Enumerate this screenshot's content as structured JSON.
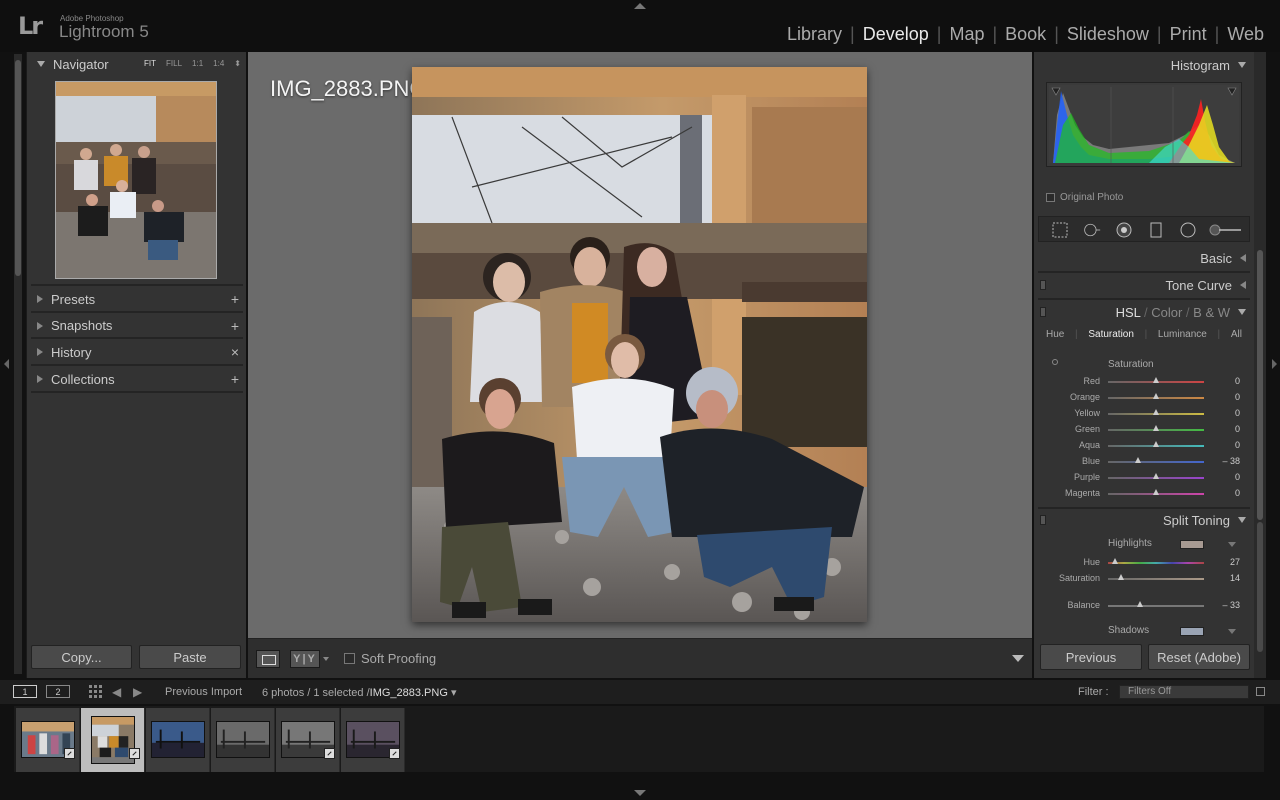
{
  "app": {
    "brand_small": "Adobe Photoshop",
    "brand_big": "Lightroom 5",
    "logo": "Lr"
  },
  "modules": [
    "Library",
    "Develop",
    "Map",
    "Book",
    "Slideshow",
    "Print",
    "Web"
  ],
  "active_module": "Develop",
  "left_panel": {
    "navigator": {
      "title": "Navigator",
      "zoom_options": [
        "FIT",
        "FILL",
        "1:1",
        "1:4"
      ],
      "active_zoom": "FIT"
    },
    "sections": [
      {
        "label": "Presets",
        "icon": "plus-icon",
        "glyph": "+"
      },
      {
        "label": "Snapshots",
        "icon": "plus-icon",
        "glyph": "+"
      },
      {
        "label": "History",
        "icon": "close-icon",
        "glyph": "×"
      },
      {
        "label": "Collections",
        "icon": "plus-icon",
        "glyph": "+"
      }
    ],
    "copy_label": "Copy...",
    "paste_label": "Paste"
  },
  "center": {
    "photo_title": "IMG_2883.PNG"
  },
  "toolbar": {
    "yy_label": "Y|Y",
    "soft_proofing_label": "Soft Proofing",
    "soft_proofing_checked": false
  },
  "right_panel": {
    "histogram_title": "Histogram",
    "original_photo_label": "Original Photo",
    "tools": [
      "crop-overlay-icon",
      "spot-removal-icon",
      "red-eye-icon",
      "graduated-filter-icon",
      "radial-filter-icon",
      "adjustment-brush-icon"
    ],
    "basic_title": "Basic",
    "tone_curve_title": "Tone Curve",
    "hsl": {
      "title_parts": [
        "HSL",
        "Color",
        "B & W"
      ],
      "tabs": [
        "Hue",
        "Saturation",
        "Luminance",
        "All"
      ],
      "active_tab": "Saturation",
      "group_title": "Saturation",
      "sliders": [
        {
          "label": "Red",
          "value": "0",
          "num": 0,
          "color": "#c44"
        },
        {
          "label": "Orange",
          "value": "0",
          "num": 0,
          "color": "#c84"
        },
        {
          "label": "Yellow",
          "value": "0",
          "num": 0,
          "color": "#cb4"
        },
        {
          "label": "Green",
          "value": "0",
          "num": 0,
          "color": "#4b4"
        },
        {
          "label": "Aqua",
          "value": "0",
          "num": 0,
          "color": "#4bb"
        },
        {
          "label": "Blue",
          "value": "– 38",
          "num": -38,
          "color": "#46c"
        },
        {
          "label": "Purple",
          "value": "0",
          "num": 0,
          "color": "#94c"
        },
        {
          "label": "Magenta",
          "value": "0",
          "num": 0,
          "color": "#c4a"
        }
      ]
    },
    "split_toning": {
      "title": "Split Toning",
      "highlights_label": "Highlights",
      "highlights_swatch": "#a79a92",
      "hue_label": "Hue",
      "hue_value": "27",
      "hue_num": 27,
      "saturation_label": "Saturation",
      "saturation_value": "14",
      "saturation_num": 14,
      "balance_label": "Balance",
      "balance_value": "– 33",
      "balance_num": -33,
      "shadows_label": "Shadows",
      "shadows_swatch": "#9aa4b4"
    },
    "previous_label": "Previous",
    "reset_label": "Reset (Adobe)"
  },
  "filmstrip_bar": {
    "screen1": "1",
    "screen2": "2",
    "source": "Previous Import",
    "count_prefix": "6 photos / 1 selected /",
    "filename": "IMG_2883.PNG",
    "filter_label": "Filter :",
    "filter_value": "Filters Off"
  },
  "filmstrip": [
    {
      "name": "thumb-1",
      "selected": false,
      "badge": true,
      "tone": "crowd"
    },
    {
      "name": "thumb-2",
      "selected": true,
      "badge": true,
      "tone": "group"
    },
    {
      "name": "thumb-3",
      "selected": false,
      "badge": false,
      "tone": "blue"
    },
    {
      "name": "thumb-4",
      "selected": false,
      "badge": false,
      "tone": "gray"
    },
    {
      "name": "thumb-5",
      "selected": false,
      "badge": true,
      "tone": "gray2"
    },
    {
      "name": "thumb-6",
      "selected": false,
      "badge": true,
      "tone": "purple"
    }
  ],
  "colors": {
    "panel": "#333333",
    "center_bg": "#6b6b6b",
    "accent_text": "#e8e8e8"
  }
}
